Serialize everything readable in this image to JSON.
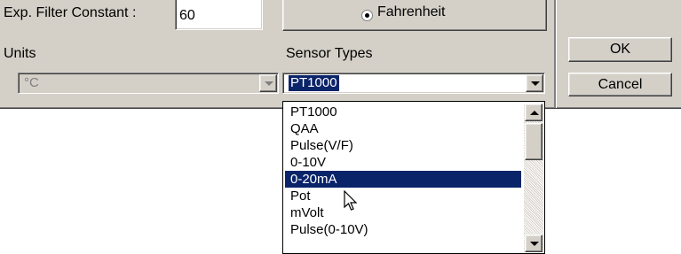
{
  "settings": {
    "filter_label": "Exp. Filter Constant :",
    "filter_value": "60",
    "fahrenheit_label": "Fahrenheit",
    "units_label": "Units",
    "units_value": "°C",
    "sensor_types_label": "Sensor Types",
    "sensor_value": "PT1000"
  },
  "buttons": {
    "ok": "OK",
    "cancel": "Cancel"
  },
  "sensor_list": {
    "items": [
      "PT1000",
      "QAA",
      "Pulse(V/F)",
      "0-10V",
      "0-20mA",
      "Pot",
      "mVolt",
      "Pulse(0-10V)"
    ],
    "selected_index": 4
  },
  "colors": {
    "face": "#d4d0c8",
    "highlight": "#0a246a"
  }
}
